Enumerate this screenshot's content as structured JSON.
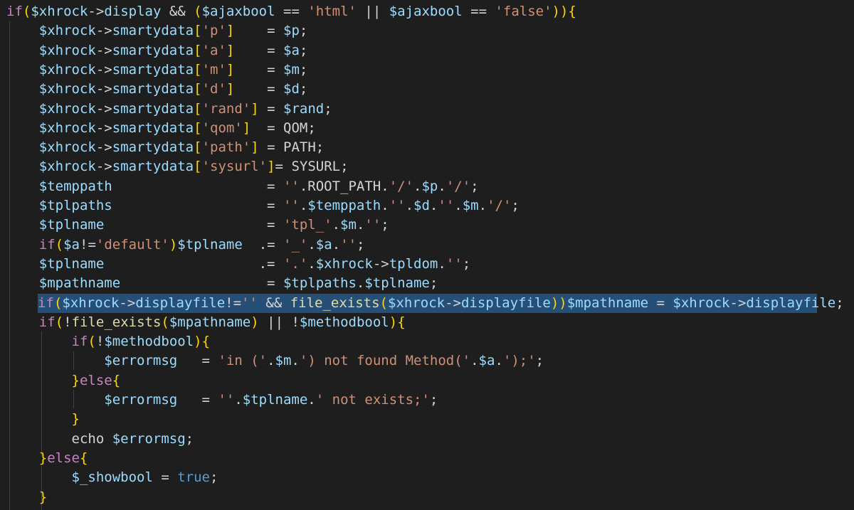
{
  "editor": {
    "language": "php",
    "theme": "dark",
    "colors": {
      "background": "#1e1e1e",
      "selection": "#264f78",
      "keyword": "#c586c0",
      "variable": "#9cdcfe",
      "string": "#ce9178",
      "function": "#dcdcaa",
      "operator": "#d4d4d4",
      "boolean": "#569cd6",
      "bracket": "#ffd700"
    },
    "selected_line_index": 15,
    "lines": [
      {
        "indent": "",
        "tokens": [
          {
            "t": "kw",
            "v": "if"
          },
          {
            "t": "brk",
            "v": "("
          },
          {
            "t": "var",
            "v": "$xhrock"
          },
          {
            "t": "op",
            "v": "->"
          },
          {
            "t": "var",
            "v": "display"
          },
          {
            "t": "op",
            "v": " && "
          },
          {
            "t": "brk",
            "v": "("
          },
          {
            "t": "var",
            "v": "$ajaxbool"
          },
          {
            "t": "op",
            "v": " == "
          },
          {
            "t": "str",
            "v": "'html'"
          },
          {
            "t": "op",
            "v": " || "
          },
          {
            "t": "var",
            "v": "$ajaxbool"
          },
          {
            "t": "op",
            "v": " == "
          },
          {
            "t": "str",
            "v": "'false'"
          },
          {
            "t": "brk",
            "v": "))"
          },
          {
            "t": "brk",
            "v": "{"
          }
        ]
      },
      {
        "indent": "    ",
        "tokens": [
          {
            "t": "var",
            "v": "$xhrock"
          },
          {
            "t": "op",
            "v": "->"
          },
          {
            "t": "var",
            "v": "smartydata"
          },
          {
            "t": "brk",
            "v": "["
          },
          {
            "t": "str",
            "v": "'p'"
          },
          {
            "t": "brk",
            "v": "]"
          },
          {
            "t": "op",
            "v": "    = "
          },
          {
            "t": "var",
            "v": "$p"
          },
          {
            "t": "op",
            "v": ";"
          }
        ]
      },
      {
        "indent": "    ",
        "tokens": [
          {
            "t": "var",
            "v": "$xhrock"
          },
          {
            "t": "op",
            "v": "->"
          },
          {
            "t": "var",
            "v": "smartydata"
          },
          {
            "t": "brk",
            "v": "["
          },
          {
            "t": "str",
            "v": "'a'"
          },
          {
            "t": "brk",
            "v": "]"
          },
          {
            "t": "op",
            "v": "    = "
          },
          {
            "t": "var",
            "v": "$a"
          },
          {
            "t": "op",
            "v": ";"
          }
        ]
      },
      {
        "indent": "    ",
        "tokens": [
          {
            "t": "var",
            "v": "$xhrock"
          },
          {
            "t": "op",
            "v": "->"
          },
          {
            "t": "var",
            "v": "smartydata"
          },
          {
            "t": "brk",
            "v": "["
          },
          {
            "t": "str",
            "v": "'m'"
          },
          {
            "t": "brk",
            "v": "]"
          },
          {
            "t": "op",
            "v": "    = "
          },
          {
            "t": "var",
            "v": "$m"
          },
          {
            "t": "op",
            "v": ";"
          }
        ]
      },
      {
        "indent": "    ",
        "tokens": [
          {
            "t": "var",
            "v": "$xhrock"
          },
          {
            "t": "op",
            "v": "->"
          },
          {
            "t": "var",
            "v": "smartydata"
          },
          {
            "t": "brk",
            "v": "["
          },
          {
            "t": "str",
            "v": "'d'"
          },
          {
            "t": "brk",
            "v": "]"
          },
          {
            "t": "op",
            "v": "    = "
          },
          {
            "t": "var",
            "v": "$d"
          },
          {
            "t": "op",
            "v": ";"
          }
        ]
      },
      {
        "indent": "    ",
        "tokens": [
          {
            "t": "var",
            "v": "$xhrock"
          },
          {
            "t": "op",
            "v": "->"
          },
          {
            "t": "var",
            "v": "smartydata"
          },
          {
            "t": "brk",
            "v": "["
          },
          {
            "t": "str",
            "v": "'rand'"
          },
          {
            "t": "brk",
            "v": "]"
          },
          {
            "t": "op",
            "v": " = "
          },
          {
            "t": "var",
            "v": "$rand"
          },
          {
            "t": "op",
            "v": ";"
          }
        ]
      },
      {
        "indent": "    ",
        "tokens": [
          {
            "t": "var",
            "v": "$xhrock"
          },
          {
            "t": "op",
            "v": "->"
          },
          {
            "t": "var",
            "v": "smartydata"
          },
          {
            "t": "brk",
            "v": "["
          },
          {
            "t": "str",
            "v": "'qom'"
          },
          {
            "t": "brk",
            "v": "]"
          },
          {
            "t": "op",
            "v": "  = "
          },
          {
            "t": "cst",
            "v": "QOM"
          },
          {
            "t": "op",
            "v": ";"
          }
        ]
      },
      {
        "indent": "    ",
        "tokens": [
          {
            "t": "var",
            "v": "$xhrock"
          },
          {
            "t": "op",
            "v": "->"
          },
          {
            "t": "var",
            "v": "smartydata"
          },
          {
            "t": "brk",
            "v": "["
          },
          {
            "t": "str",
            "v": "'path'"
          },
          {
            "t": "brk",
            "v": "]"
          },
          {
            "t": "op",
            "v": " = "
          },
          {
            "t": "cst",
            "v": "PATH"
          },
          {
            "t": "op",
            "v": ";"
          }
        ]
      },
      {
        "indent": "    ",
        "tokens": [
          {
            "t": "var",
            "v": "$xhrock"
          },
          {
            "t": "op",
            "v": "->"
          },
          {
            "t": "var",
            "v": "smartydata"
          },
          {
            "t": "brk",
            "v": "["
          },
          {
            "t": "str",
            "v": "'sysurl'"
          },
          {
            "t": "brk",
            "v": "]"
          },
          {
            "t": "op",
            "v": "= "
          },
          {
            "t": "cst",
            "v": "SYSURL"
          },
          {
            "t": "op",
            "v": ";"
          }
        ]
      },
      {
        "indent": "    ",
        "tokens": [
          {
            "t": "var",
            "v": "$temppath"
          },
          {
            "t": "op",
            "v": "                   = "
          },
          {
            "t": "str",
            "v": "''"
          },
          {
            "t": "op",
            "v": "."
          },
          {
            "t": "cst",
            "v": "ROOT_PATH"
          },
          {
            "t": "op",
            "v": "."
          },
          {
            "t": "str",
            "v": "'/'"
          },
          {
            "t": "op",
            "v": "."
          },
          {
            "t": "var",
            "v": "$p"
          },
          {
            "t": "op",
            "v": "."
          },
          {
            "t": "str",
            "v": "'/'"
          },
          {
            "t": "op",
            "v": ";"
          }
        ]
      },
      {
        "indent": "    ",
        "tokens": [
          {
            "t": "var",
            "v": "$tplpaths"
          },
          {
            "t": "op",
            "v": "                   = "
          },
          {
            "t": "str",
            "v": "''"
          },
          {
            "t": "op",
            "v": "."
          },
          {
            "t": "var",
            "v": "$temppath"
          },
          {
            "t": "op",
            "v": "."
          },
          {
            "t": "str",
            "v": "''"
          },
          {
            "t": "op",
            "v": "."
          },
          {
            "t": "var",
            "v": "$d"
          },
          {
            "t": "op",
            "v": "."
          },
          {
            "t": "str",
            "v": "''"
          },
          {
            "t": "op",
            "v": "."
          },
          {
            "t": "var",
            "v": "$m"
          },
          {
            "t": "op",
            "v": "."
          },
          {
            "t": "str",
            "v": "'/'"
          },
          {
            "t": "op",
            "v": ";"
          }
        ]
      },
      {
        "indent": "    ",
        "tokens": [
          {
            "t": "var",
            "v": "$tplname"
          },
          {
            "t": "op",
            "v": "                    = "
          },
          {
            "t": "str",
            "v": "'tpl_'"
          },
          {
            "t": "op",
            "v": "."
          },
          {
            "t": "var",
            "v": "$m"
          },
          {
            "t": "op",
            "v": "."
          },
          {
            "t": "str",
            "v": "''"
          },
          {
            "t": "op",
            "v": ";"
          }
        ]
      },
      {
        "indent": "    ",
        "tokens": [
          {
            "t": "kw",
            "v": "if"
          },
          {
            "t": "brk",
            "v": "("
          },
          {
            "t": "var",
            "v": "$a"
          },
          {
            "t": "op",
            "v": "!="
          },
          {
            "t": "str",
            "v": "'default'"
          },
          {
            "t": "brk",
            "v": ")"
          },
          {
            "t": "var",
            "v": "$tplname"
          },
          {
            "t": "op",
            "v": "  .= "
          },
          {
            "t": "str",
            "v": "'_'"
          },
          {
            "t": "op",
            "v": "."
          },
          {
            "t": "var",
            "v": "$a"
          },
          {
            "t": "op",
            "v": "."
          },
          {
            "t": "str",
            "v": "''"
          },
          {
            "t": "op",
            "v": ";"
          }
        ]
      },
      {
        "indent": "    ",
        "tokens": [
          {
            "t": "var",
            "v": "$tplname"
          },
          {
            "t": "op",
            "v": "                   .= "
          },
          {
            "t": "str",
            "v": "'.'"
          },
          {
            "t": "op",
            "v": "."
          },
          {
            "t": "var",
            "v": "$xhrock"
          },
          {
            "t": "op",
            "v": "->"
          },
          {
            "t": "var",
            "v": "tpldom"
          },
          {
            "t": "op",
            "v": "."
          },
          {
            "t": "str",
            "v": "''"
          },
          {
            "t": "op",
            "v": ";"
          }
        ]
      },
      {
        "indent": "    ",
        "tokens": [
          {
            "t": "var",
            "v": "$mpathname"
          },
          {
            "t": "op",
            "v": "                  = "
          },
          {
            "t": "var",
            "v": "$tplpaths"
          },
          {
            "t": "op",
            "v": "."
          },
          {
            "t": "var",
            "v": "$tplname"
          },
          {
            "t": "op",
            "v": ";"
          }
        ]
      },
      {
        "indent": "",
        "tokens": [
          {
            "t": "kw",
            "v": "if"
          },
          {
            "t": "brk",
            "v": "("
          },
          {
            "t": "var",
            "v": "$xhrock"
          },
          {
            "t": "op",
            "v": "->"
          },
          {
            "t": "var",
            "v": "displayfile"
          },
          {
            "t": "op",
            "v": "!="
          },
          {
            "t": "str",
            "v": "''"
          },
          {
            "t": "op",
            "v": " && "
          },
          {
            "t": "fn",
            "v": "file_exists"
          },
          {
            "t": "brk",
            "v": "("
          },
          {
            "t": "var",
            "v": "$xhrock"
          },
          {
            "t": "op",
            "v": "->"
          },
          {
            "t": "var",
            "v": "displayfile"
          },
          {
            "t": "brk",
            "v": "))"
          },
          {
            "t": "var",
            "v": "$mpathname"
          },
          {
            "t": "op",
            "v": " = "
          },
          {
            "t": "var",
            "v": "$xhrock"
          },
          {
            "t": "op",
            "v": "->"
          },
          {
            "t": "var",
            "v": "displayfile"
          },
          {
            "t": "op",
            "v": ";"
          }
        ]
      },
      {
        "indent": "    ",
        "tokens": [
          {
            "t": "kw",
            "v": "if"
          },
          {
            "t": "brk",
            "v": "("
          },
          {
            "t": "op",
            "v": "!"
          },
          {
            "t": "fn",
            "v": "file_exists"
          },
          {
            "t": "brk",
            "v": "("
          },
          {
            "t": "var",
            "v": "$mpathname"
          },
          {
            "t": "brk",
            "v": ")"
          },
          {
            "t": "op",
            "v": " || !"
          },
          {
            "t": "var",
            "v": "$methodbool"
          },
          {
            "t": "brk",
            "v": ")"
          },
          {
            "t": "brk",
            "v": "{"
          }
        ]
      },
      {
        "indent": "        ",
        "tokens": [
          {
            "t": "kw",
            "v": "if"
          },
          {
            "t": "brk",
            "v": "("
          },
          {
            "t": "op",
            "v": "!"
          },
          {
            "t": "var",
            "v": "$methodbool"
          },
          {
            "t": "brk",
            "v": ")"
          },
          {
            "t": "brk",
            "v": "{"
          }
        ]
      },
      {
        "indent": "            ",
        "tokens": [
          {
            "t": "var",
            "v": "$errormsg"
          },
          {
            "t": "op",
            "v": "   = "
          },
          {
            "t": "str",
            "v": "'in ('"
          },
          {
            "t": "op",
            "v": "."
          },
          {
            "t": "var",
            "v": "$m"
          },
          {
            "t": "op",
            "v": "."
          },
          {
            "t": "str",
            "v": "') not found Method('"
          },
          {
            "t": "op",
            "v": "."
          },
          {
            "t": "var",
            "v": "$a"
          },
          {
            "t": "op",
            "v": "."
          },
          {
            "t": "str",
            "v": "');'"
          },
          {
            "t": "op",
            "v": ";"
          }
        ]
      },
      {
        "indent": "        ",
        "tokens": [
          {
            "t": "brk",
            "v": "}"
          },
          {
            "t": "kw",
            "v": "else"
          },
          {
            "t": "brk",
            "v": "{"
          }
        ]
      },
      {
        "indent": "            ",
        "tokens": [
          {
            "t": "var",
            "v": "$errormsg"
          },
          {
            "t": "op",
            "v": "   = "
          },
          {
            "t": "str",
            "v": "''"
          },
          {
            "t": "op",
            "v": "."
          },
          {
            "t": "var",
            "v": "$tplname"
          },
          {
            "t": "op",
            "v": "."
          },
          {
            "t": "str",
            "v": "' not exists;'"
          },
          {
            "t": "op",
            "v": ";"
          }
        ]
      },
      {
        "indent": "        ",
        "tokens": [
          {
            "t": "brk",
            "v": "}"
          }
        ]
      },
      {
        "indent": "        ",
        "tokens": [
          {
            "t": "pln",
            "v": "echo "
          },
          {
            "t": "var",
            "v": "$errormsg"
          },
          {
            "t": "op",
            "v": ";"
          }
        ]
      },
      {
        "indent": "    ",
        "tokens": [
          {
            "t": "brk",
            "v": "}"
          },
          {
            "t": "kw",
            "v": "else"
          },
          {
            "t": "brk",
            "v": "{"
          }
        ]
      },
      {
        "indent": "        ",
        "tokens": [
          {
            "t": "var",
            "v": "$_showbool"
          },
          {
            "t": "op",
            "v": " = "
          },
          {
            "t": "bool",
            "v": "true"
          },
          {
            "t": "op",
            "v": ";"
          }
        ]
      },
      {
        "indent": "    ",
        "tokens": [
          {
            "t": "brk",
            "v": "}"
          }
        ]
      }
    ]
  }
}
